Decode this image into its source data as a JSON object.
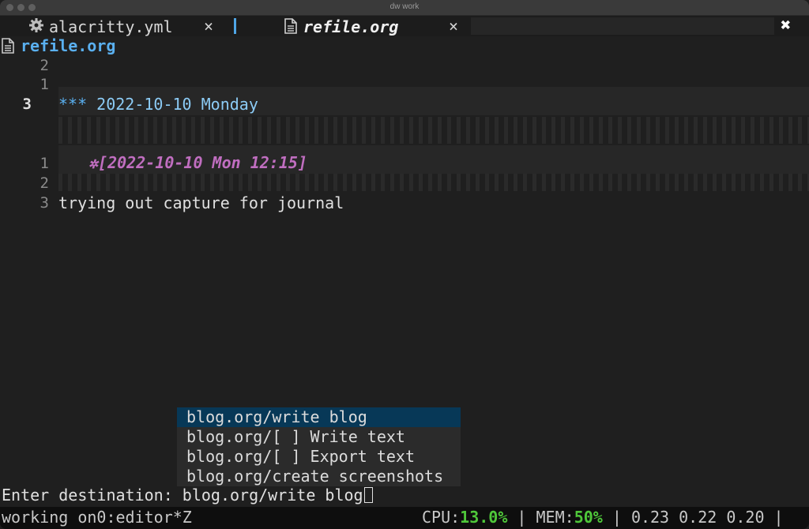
{
  "window": {
    "title": "dw work"
  },
  "tabs": [
    {
      "label": "alacritty.yml",
      "icon": "gear-icon",
      "close": "×",
      "active": false
    },
    {
      "label": "refile.org",
      "icon": "document-icon",
      "close": "×",
      "active": true
    }
  ],
  "window_close": "✖",
  "header": {
    "title": "refile.org",
    "icon": "document-icon"
  },
  "editor": {
    "line_numbers": [
      "2",
      "1",
      "3",
      "1",
      "2",
      "3"
    ],
    "heading": {
      "stars": "***",
      "text": " 2022-10-10 Monday"
    },
    "timestamp": {
      "bullet": "✲",
      "text": "[2022-10-10 Mon 12:15]"
    },
    "body": "trying out capture for journal"
  },
  "completion": {
    "items": [
      "blog.org/write blog",
      "blog.org/[ ] Write text",
      "blog.org/[ ] Export text",
      "blog.org/create screenshots"
    ],
    "selected_index": 0
  },
  "minibuffer": {
    "prompt": "Enter destination: ",
    "input": "blog.org/write blog"
  },
  "statusbar": {
    "session": "working on0:editor*Z",
    "cpu_label": "CPU:",
    "cpu_value": "13.0%",
    "sep1": " | ",
    "mem_label": "MEM:",
    "mem_value": "50%",
    "sep2": " | ",
    "load": "0.23 0.22 0.20",
    "sep3": " |"
  },
  "colors": {
    "accent": "#5ab0f0",
    "heading_stars": "#5ab0f0",
    "heading_text": "#8ccbf5",
    "timestamp": "#c06ec0",
    "selection": "#073857",
    "status_green": "#4fc83a"
  }
}
